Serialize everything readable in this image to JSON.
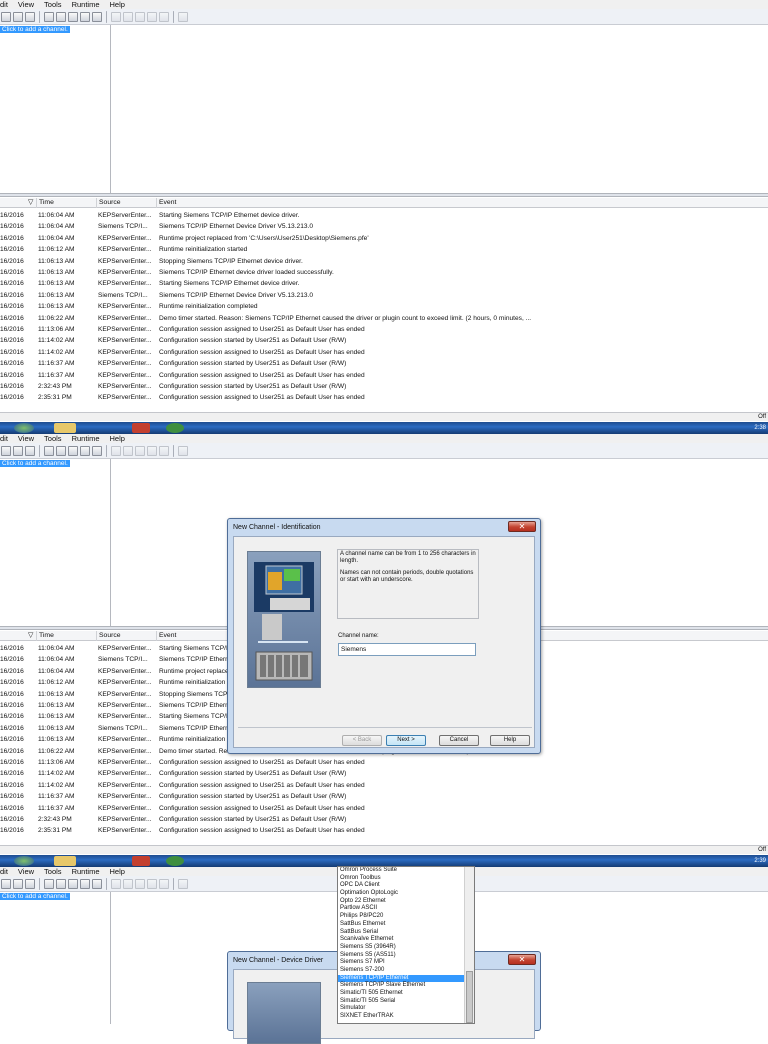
{
  "menu": [
    "dit",
    "View",
    "Tools",
    "Runtime",
    "Help"
  ],
  "tree": {
    "add_channel": "Click to add a channel."
  },
  "log_headers": {
    "time": "Time",
    "source": "Source",
    "event": "Event"
  },
  "log_rows": [
    {
      "date": "16/2016",
      "time": "11:06:04 AM",
      "source": "KEPServerEnter...",
      "event": "Starting Siemens TCP/IP Ethernet device driver."
    },
    {
      "date": "16/2016",
      "time": "11:06:04 AM",
      "source": "Siemens TCP/I...",
      "event": "Siemens TCP/IP Ethernet Device Driver V5.13.213.0"
    },
    {
      "date": "16/2016",
      "time": "11:06:04 AM",
      "source": "KEPServerEnter...",
      "event": "Runtime project replaced from 'C:\\Users\\User251\\Desktop\\Siemens.pfe'"
    },
    {
      "date": "16/2016",
      "time": "11:06:12 AM",
      "source": "KEPServerEnter...",
      "event": "Runtime reinitialization started"
    },
    {
      "date": "16/2016",
      "time": "11:06:13 AM",
      "source": "KEPServerEnter...",
      "event": "Stopping Siemens TCP/IP Ethernet device driver."
    },
    {
      "date": "16/2016",
      "time": "11:06:13 AM",
      "source": "KEPServerEnter...",
      "event": "Siemens TCP/IP Ethernet device driver loaded successfully."
    },
    {
      "date": "16/2016",
      "time": "11:06:13 AM",
      "source": "KEPServerEnter...",
      "event": "Starting Siemens TCP/IP Ethernet device driver."
    },
    {
      "date": "16/2016",
      "time": "11:06:13 AM",
      "source": "Siemens TCP/I...",
      "event": "Siemens TCP/IP Ethernet Device Driver V5.13.213.0"
    },
    {
      "date": "16/2016",
      "time": "11:06:13 AM",
      "source": "KEPServerEnter...",
      "event": "Runtime reinitialization completed"
    },
    {
      "date": "16/2016",
      "time": "11:06:22 AM",
      "source": "KEPServerEnter...",
      "event": "Demo timer started. Reason: Siemens TCP/IP Ethernet caused the driver or plugin count to exceed limit. (2 hours, 0 minutes, ..."
    },
    {
      "date": "16/2016",
      "time": "11:13:06 AM",
      "source": "KEPServerEnter...",
      "event": "Configuration session assigned to User251 as Default User has ended"
    },
    {
      "date": "16/2016",
      "time": "11:14:02 AM",
      "source": "KEPServerEnter...",
      "event": "Configuration session started by User251 as Default User (R/W)"
    },
    {
      "date": "16/2016",
      "time": "11:14:02 AM",
      "source": "KEPServerEnter...",
      "event": "Configuration session assigned to User251 as Default User has ended"
    },
    {
      "date": "16/2016",
      "time": "11:16:37 AM",
      "source": "KEPServerEnter...",
      "event": "Configuration session started by User251 as Default User (R/W)"
    },
    {
      "date": "16/2016",
      "time": "11:16:37 AM",
      "source": "KEPServerEnter...",
      "event": "Configuration session assigned to User251 as Default User has ended"
    },
    {
      "date": "16/2016",
      "time": "2:32:43 PM",
      "source": "KEPServerEnter...",
      "event": "Configuration session started by User251 as Default User (R/W)"
    },
    {
      "date": "16/2016",
      "time": "2:35:31 PM",
      "source": "KEPServerEnter...",
      "event": "Configuration session assigned to User251 as Default User has ended"
    }
  ],
  "status": {
    "right": "Off"
  },
  "clock": {
    "p1": "2:38",
    "p2": "2:39"
  },
  "dialog1": {
    "title": "New Channel - Identification",
    "close": "✕",
    "info1": "A channel name can be from 1 to 256 characters in length.",
    "info2": "Names can not contain periods, double quotations or start with an underscore.",
    "name_label": "Channel name:",
    "name_value": "Siemens",
    "back": "< Back",
    "next": "Next >",
    "cancel": "Cancel",
    "help": "Help"
  },
  "dialog2": {
    "title": "New Channel - Device Driver",
    "close": "✕"
  },
  "driver_list": [
    "Omron Process Suite",
    "Omron Toolbus",
    "OPC DA Client",
    "Optimation OptoLogic",
    "Opto 22 Ethernet",
    "Partlow ASCII",
    "Philips P8/PC20",
    "SattBus Ethernet",
    "SattBus Serial",
    "Scanivalve Ethernet",
    "Siemens S5 (3964R)",
    "Siemens S5 (AS511)",
    "Siemens S7 MPI",
    "Siemens S7-200",
    "Siemens TCP/IP Ethernet",
    "Siemens TCP/IP Slave Ethernet",
    "Simatic/TI 505 Ethernet",
    "Simatic/TI 505 Serial",
    "Simulator",
    "SIXNET EtherTRAK"
  ],
  "driver_selected_index": 14
}
